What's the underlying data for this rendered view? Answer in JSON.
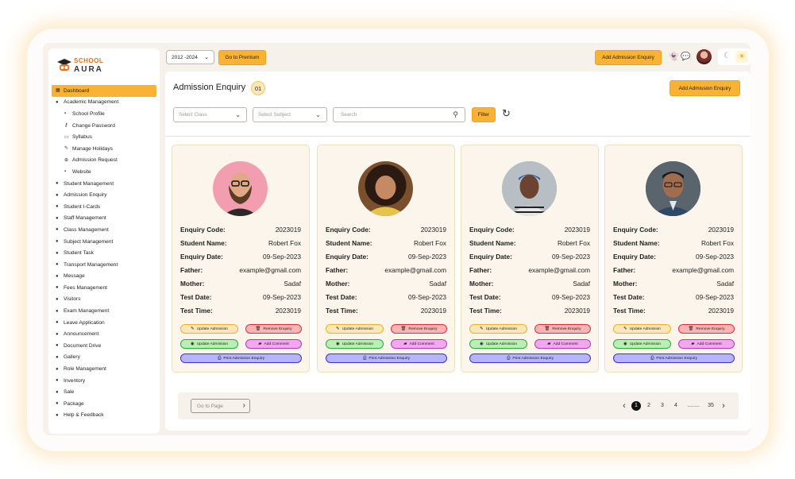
{
  "brand": {
    "line1": "SCHOOL",
    "line2": "AURA"
  },
  "sidebar": {
    "items": [
      {
        "label": "Dashboard",
        "icon": "dashboard-icon",
        "active": true,
        "sub": false
      },
      {
        "label": "Academic Management",
        "icon": "cap-icon",
        "sub": false
      },
      {
        "label": "School Profile",
        "icon": "profile-icon",
        "sub": true
      },
      {
        "label": "Change Password",
        "icon": "key-icon",
        "sub": true
      },
      {
        "label": "Syllabus",
        "icon": "book-icon",
        "sub": true
      },
      {
        "label": "Manage Holidays",
        "icon": "pen-icon",
        "sub": true
      },
      {
        "label": "Admission Request",
        "icon": "request-icon",
        "sub": true
      },
      {
        "label": "Website",
        "icon": "web-icon",
        "sub": true
      },
      {
        "label": "Student Management",
        "icon": "cap-icon",
        "sub": false
      },
      {
        "label": "Admission Enquiry",
        "icon": "cap-icon",
        "sub": false
      },
      {
        "label": "Student I-Cards",
        "icon": "cap-icon",
        "sub": false
      },
      {
        "label": "Staff Management",
        "icon": "cap-icon",
        "sub": false
      },
      {
        "label": "Class Management",
        "icon": "cap-icon",
        "sub": false
      },
      {
        "label": "Subject Management",
        "icon": "cap-icon",
        "sub": false
      },
      {
        "label": "Student Task",
        "icon": "cap-icon",
        "sub": false
      },
      {
        "label": "Transport Management",
        "icon": "cap-icon",
        "sub": false
      },
      {
        "label": "Message",
        "icon": "cap-icon",
        "sub": false
      },
      {
        "label": "Fees Management",
        "icon": "cap-icon",
        "sub": false
      },
      {
        "label": "Visitors",
        "icon": "cap-icon",
        "sub": false
      },
      {
        "label": "Exam Management",
        "icon": "cap-icon",
        "sub": false
      },
      {
        "label": "Leave Application",
        "icon": "cap-icon",
        "sub": false
      },
      {
        "label": "Announcement",
        "icon": "cap-icon",
        "sub": false
      },
      {
        "label": "Document Drive",
        "icon": "cap-icon",
        "sub": false
      },
      {
        "label": "Gallery",
        "icon": "cap-icon",
        "sub": false
      },
      {
        "label": "Role Management",
        "icon": "cap-icon",
        "sub": false
      },
      {
        "label": "Inventory",
        "icon": "cap-icon",
        "sub": false
      },
      {
        "label": "Sale",
        "icon": "cap-icon",
        "sub": false
      },
      {
        "label": "Package",
        "icon": "cap-icon",
        "sub": false
      },
      {
        "label": "Help & Feedback",
        "icon": "cap-icon",
        "sub": false
      }
    ]
  },
  "topbar": {
    "year": "2012 -2024",
    "premium_label": "Go to Premium",
    "add_enquiry_label": "Add Admission Enquiry",
    "icons": [
      "snapchat-icon",
      "chat-icon",
      "user-avatar",
      "moon-icon",
      "sun-icon"
    ]
  },
  "main": {
    "title": "Admission Enquiry",
    "count": "01",
    "add_label": "Add Admission Enquiry",
    "filters": {
      "class_placeholder": "Select Class",
      "subject_placeholder": "Select Subject",
      "search_placeholder": "Search",
      "filter_label": "Filter"
    },
    "labels": {
      "code": "Enquiry Code:",
      "name": "Student Name:",
      "date": "Enquiry Date:",
      "father": "Father:",
      "mother": "Mother:",
      "test_date": "Test Date:",
      "test_time": "Test Time:"
    },
    "actions": {
      "update": "Update Admission",
      "remove": "Remove Enquiry",
      "update_adm": "Update Admission",
      "comment": "Add Comment",
      "print": "Print Admission Enquiry"
    },
    "cards": [
      {
        "code": "2023019",
        "name": "Robert Fox",
        "date": "09-Sep-2023",
        "father": "example@gmail.com",
        "mother": "Sadaf",
        "test_date": "09-Sep-2023",
        "test_time": "2023019"
      },
      {
        "code": "2023019",
        "name": "Robert Fox",
        "date": "09-Sep-2023",
        "father": "example@gmail.com",
        "mother": "Sadaf",
        "test_date": "09-Sep-2023",
        "test_time": "2023019"
      },
      {
        "code": "2023019",
        "name": "Robert Fox",
        "date": "09-Sep-2023",
        "father": "example@gmail.com",
        "mother": "Sadaf",
        "test_date": "09-Sep-2023",
        "test_time": "2023019"
      },
      {
        "code": "2023019",
        "name": "Robert Fox",
        "date": "09-Sep-2023",
        "father": "example@gmail.com",
        "mother": "Sadaf",
        "test_date": "09-Sep-2023",
        "test_time": "2023019"
      }
    ]
  },
  "pagination": {
    "goto_placeholder": "Go to Page",
    "pages": [
      "1",
      "2",
      "3",
      "4",
      "........",
      "35"
    ],
    "current": "1"
  },
  "colors": {
    "accent": "#f9b233",
    "panel": "#f6f1ea",
    "card": "#fbf5ec"
  }
}
